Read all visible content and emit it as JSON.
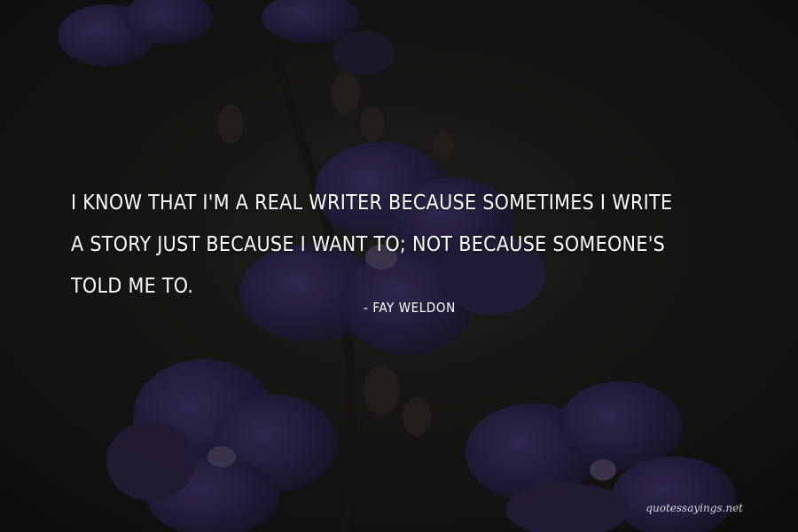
{
  "quote": {
    "lines": [
      "I KNOW THAT I'M A REAL WRITER BECAUSE SOMETIMES I WRITE",
      "A STORY JUST BECAUSE I WANT TO; NOT BECAUSE SOMEONE'S",
      "TOLD ME TO."
    ],
    "author": "- FAY WELDON"
  },
  "watermark": "quotessayings.net",
  "colors": {
    "background": "#1b1a18",
    "petal": "#2a2140",
    "petal_light": "#3b2f5e",
    "text": "#ffffff"
  }
}
